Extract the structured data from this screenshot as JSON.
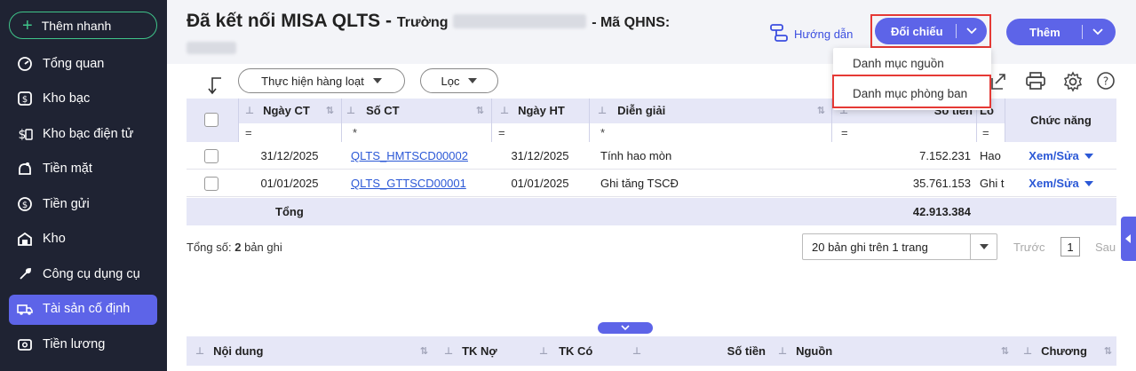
{
  "sidebar": {
    "quick_add": "Thêm nhanh",
    "items": [
      {
        "label": "Tổng quan",
        "icon": "dashboard-icon"
      },
      {
        "label": "Kho bạc",
        "icon": "treasury-icon"
      },
      {
        "label": "Kho bạc điện tử",
        "icon": "e-treasury-icon"
      },
      {
        "label": "Tiền mặt",
        "icon": "cash-icon"
      },
      {
        "label": "Tiền gửi",
        "icon": "deposit-icon"
      },
      {
        "label": "Kho",
        "icon": "warehouse-icon"
      },
      {
        "label": "Công cụ dụng cụ",
        "icon": "tools-icon"
      },
      {
        "label": "Tài sản cố định",
        "icon": "truck-icon",
        "active": true
      },
      {
        "label": "Tiền lương",
        "icon": "salary-icon"
      }
    ]
  },
  "header": {
    "title": "Đã kết nối MISA QLTS",
    "dash": "-",
    "school_prefix": "Trường",
    "qhns_label": "- Mã QHNS:",
    "guide": "Hướng dẫn",
    "reconcile": "Đối chiếu",
    "add": "Thêm"
  },
  "dropdown": {
    "items": [
      "Danh mục nguồn",
      "Danh mục phòng ban"
    ]
  },
  "toolbar": {
    "bulk": "Thực hiện hàng loạt",
    "filter": "Lọc"
  },
  "table": {
    "columns": [
      "Ngày CT",
      "Số CT",
      "Ngày HT",
      "Diễn giải",
      "Số tiền",
      "Lo",
      "Chức năng"
    ],
    "filters": [
      "=",
      "*",
      "=",
      "*",
      "=",
      "="
    ],
    "rows": [
      {
        "ngay_ct": "31/12/2025",
        "so_ct": "QLTS_HMTSCD00002",
        "ngay_ht": "31/12/2025",
        "dien_giai": "Tính hao mòn",
        "so_tien": "7.152.231",
        "loai": "Hao",
        "action": "Xem/Sửa"
      },
      {
        "ngay_ct": "01/01/2025",
        "so_ct": "QLTS_GTTSCD00001",
        "ngay_ht": "01/01/2025",
        "dien_giai": "Ghi tăng TSCĐ",
        "so_tien": "35.761.153",
        "loai": "Ghi t",
        "action": "Xem/Sửa"
      }
    ],
    "total_label": "Tổng",
    "total_value": "42.913.384"
  },
  "footer": {
    "count_prefix": "Tổng số:",
    "count_value": "2",
    "count_suffix": "bản ghi",
    "page_size": "20 bản ghi trên 1 trang",
    "prev": "Trước",
    "page": "1",
    "next": "Sau"
  },
  "detail": {
    "columns": [
      "Nội dung",
      "TK Nợ",
      "TK Có",
      "Số tiền",
      "Nguồn",
      "Chương"
    ]
  },
  "colors": {
    "accent": "#5d64e8",
    "sidebar": "#1f2333",
    "highlight": "#e53935",
    "link": "#2b58d6"
  }
}
